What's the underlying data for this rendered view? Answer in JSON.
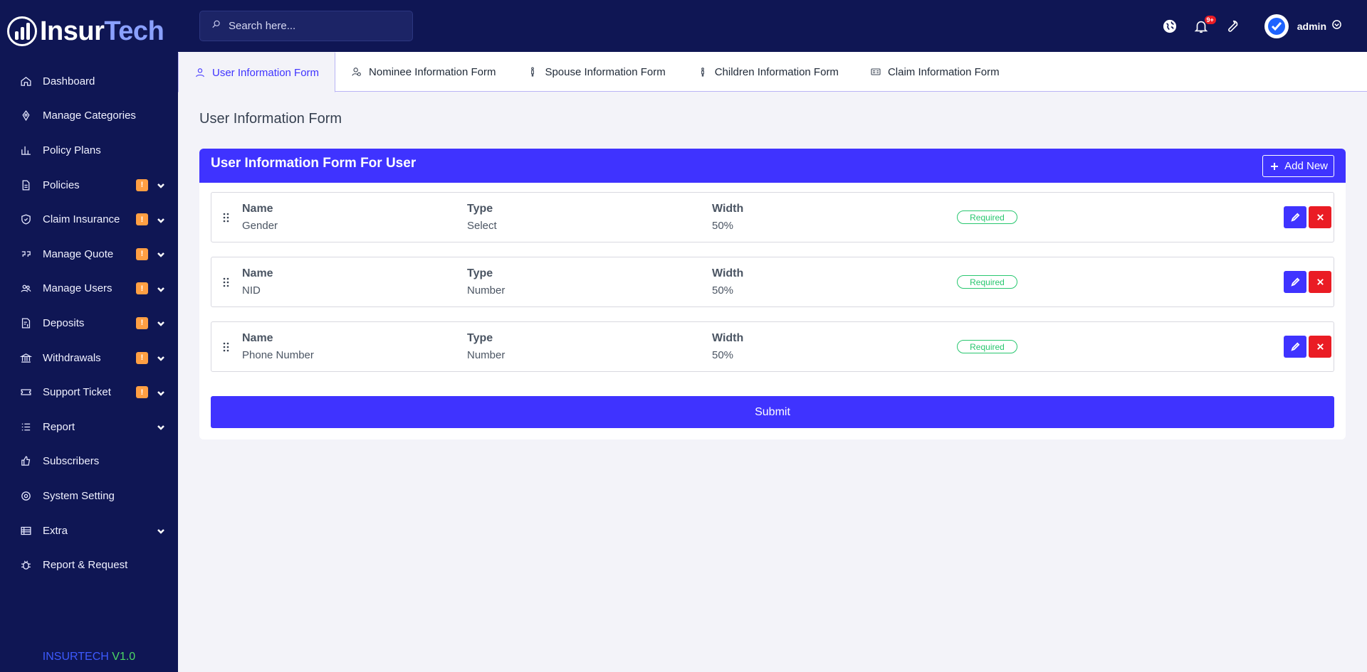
{
  "brand": {
    "logo_part1": "Insur",
    "logo_part2": "Tech",
    "version_name": "INSURTECH",
    "version_num": "V1.0"
  },
  "search": {
    "placeholder": "Search here..."
  },
  "header": {
    "notif_count": "9+",
    "user": "admin"
  },
  "sidebar": {
    "items": [
      {
        "label": "Dashboard",
        "icon": "home-icon"
      },
      {
        "label": "Manage Categories",
        "icon": "tag-icon"
      },
      {
        "label": "Policy Plans",
        "icon": "chart-icon"
      },
      {
        "label": "Policies",
        "icon": "document-icon",
        "badge": "!",
        "expandable": true
      },
      {
        "label": "Claim Insurance",
        "icon": "shield-icon",
        "badge": "!",
        "expandable": true
      },
      {
        "label": "Manage Quote",
        "icon": "quote-icon",
        "badge": "!",
        "expandable": true
      },
      {
        "label": "Manage Users",
        "icon": "users-icon",
        "badge": "!",
        "expandable": true
      },
      {
        "label": "Deposits",
        "icon": "deposit-icon",
        "badge": "!",
        "expandable": true
      },
      {
        "label": "Withdrawals",
        "icon": "bank-icon",
        "badge": "!",
        "expandable": true
      },
      {
        "label": "Support Ticket",
        "icon": "ticket-icon",
        "badge": "!",
        "expandable": true
      },
      {
        "label": "Report",
        "icon": "list-icon",
        "expandable": true
      },
      {
        "label": "Subscribers",
        "icon": "thumbs-up-icon"
      },
      {
        "label": "System Setting",
        "icon": "settings-icon"
      },
      {
        "label": "Extra",
        "icon": "table-icon",
        "expandable": true
      },
      {
        "label": "Report & Request",
        "icon": "bug-icon"
      }
    ]
  },
  "tabs": [
    {
      "label": "User Information Form",
      "active": true
    },
    {
      "label": "Nominee Information Form"
    },
    {
      "label": "Spouse Information Form"
    },
    {
      "label": "Children Information Form"
    },
    {
      "label": "Claim Information Form"
    }
  ],
  "main": {
    "page_title": "User Information Form",
    "card_title": "User Information Form For User",
    "add_label": "Add New",
    "col_name": "Name",
    "col_type": "Type",
    "col_width": "Width",
    "fields": [
      {
        "name": "Gender",
        "type": "Select",
        "width": "50%",
        "status": "Required"
      },
      {
        "name": "NID",
        "type": "Number",
        "width": "50%",
        "status": "Required"
      },
      {
        "name": "Phone Number",
        "type": "Number",
        "width": "50%",
        "status": "Required"
      }
    ],
    "submit_label": "Submit"
  },
  "colors": {
    "sidebar": "#0f1654",
    "primary": "#3f33ff",
    "danger": "#ea1c24",
    "success": "#28c76f",
    "warning": "#ff9f43"
  }
}
